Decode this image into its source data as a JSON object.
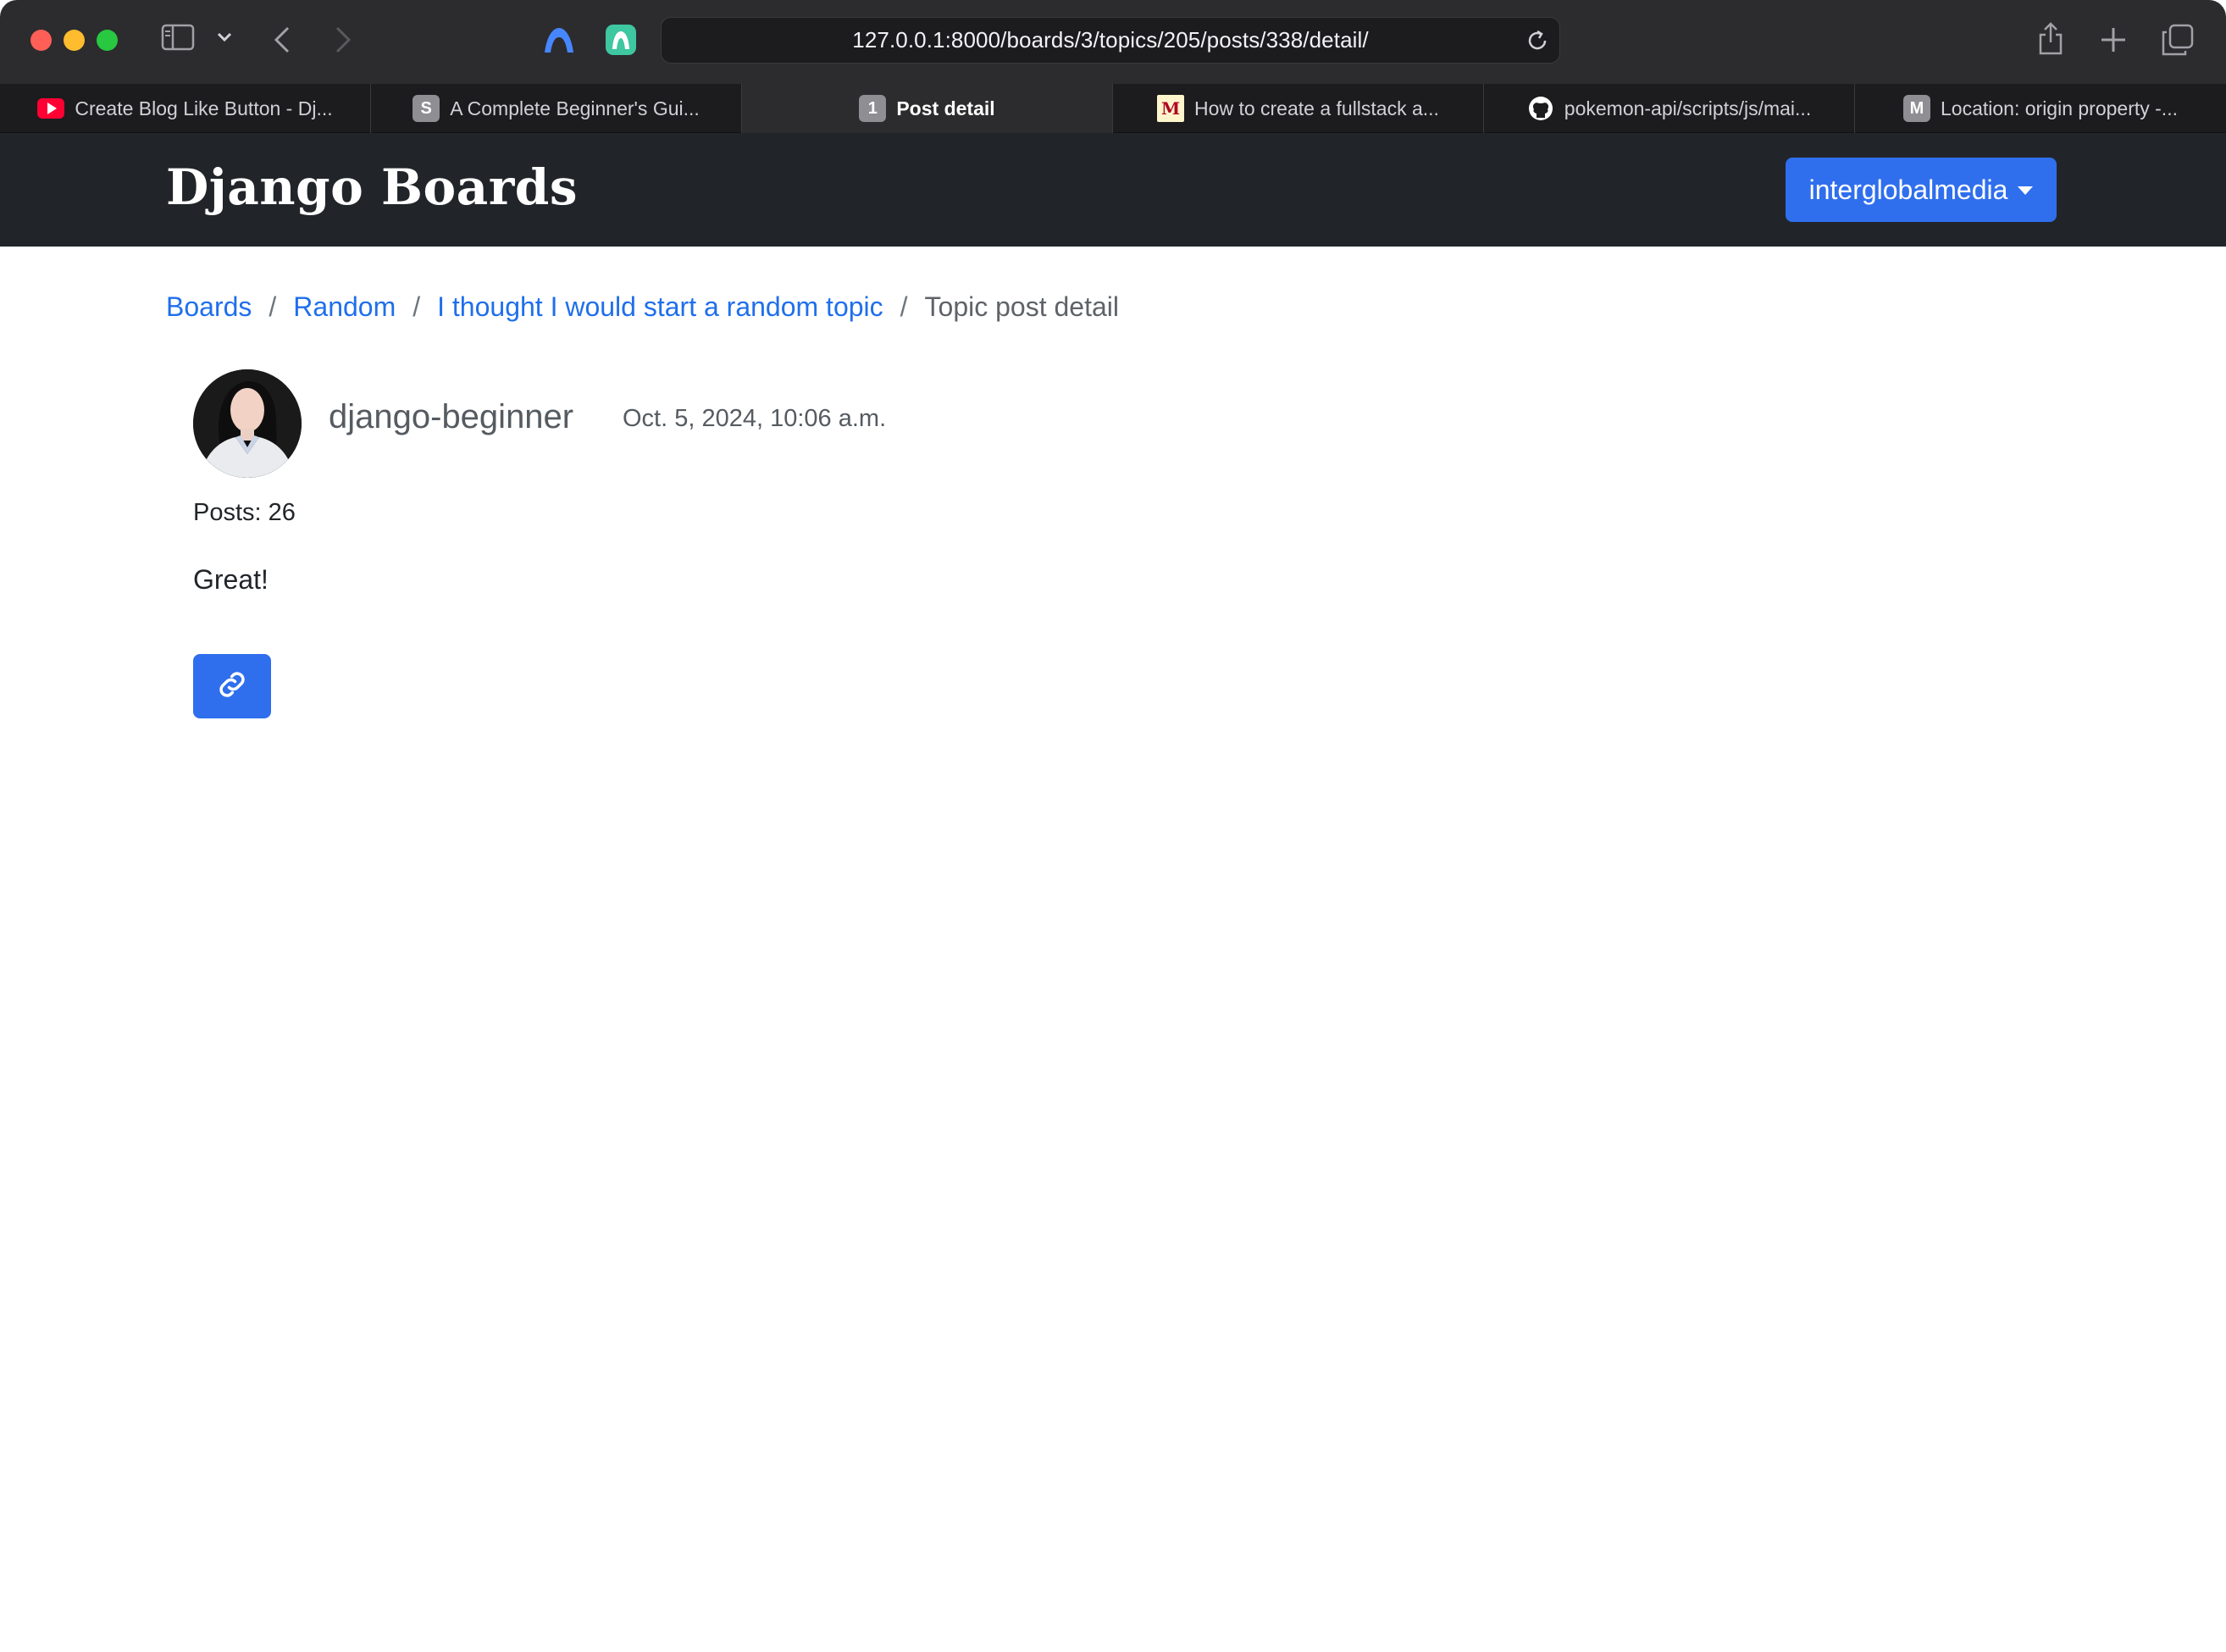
{
  "browser": {
    "url": "127.0.0.1:8000/boards/3/topics/205/posts/338/detail/",
    "tabs": [
      {
        "label": "Create Blog Like Button - Dj...",
        "icon": "youtube-icon",
        "active": false
      },
      {
        "label": "A Complete Beginner's Gui...",
        "icon": "s-favicon",
        "favicon_text": "S",
        "active": false
      },
      {
        "label": "Post detail",
        "icon": "number-favicon",
        "favicon_text": "1",
        "active": true
      },
      {
        "label": "How to create a fullstack a...",
        "icon": "m-favicon",
        "favicon_text": "M",
        "active": false
      },
      {
        "label": "pokemon-api/scripts/js/mai...",
        "icon": "github-icon",
        "active": false
      },
      {
        "label": "Location: origin property -...",
        "icon": "m-favicon",
        "favicon_text": "M",
        "active": false
      }
    ]
  },
  "navbar": {
    "brand": "Django Boards",
    "user_menu": "interglobalmedia"
  },
  "breadcrumb": {
    "boards": "Boards",
    "board": "Random",
    "topic": "I thought I would start a random topic",
    "current": "Topic post detail",
    "separator": "/"
  },
  "post": {
    "author": "django-beginner",
    "date": "Oct. 5, 2024, 10:06 a.m.",
    "posts_count": "Posts: 26",
    "message": "Great!",
    "link_icon": "link-icon"
  },
  "colors": {
    "primary": "#2f6fed",
    "navbar_bg": "#212529",
    "link": "#1f6feb"
  }
}
